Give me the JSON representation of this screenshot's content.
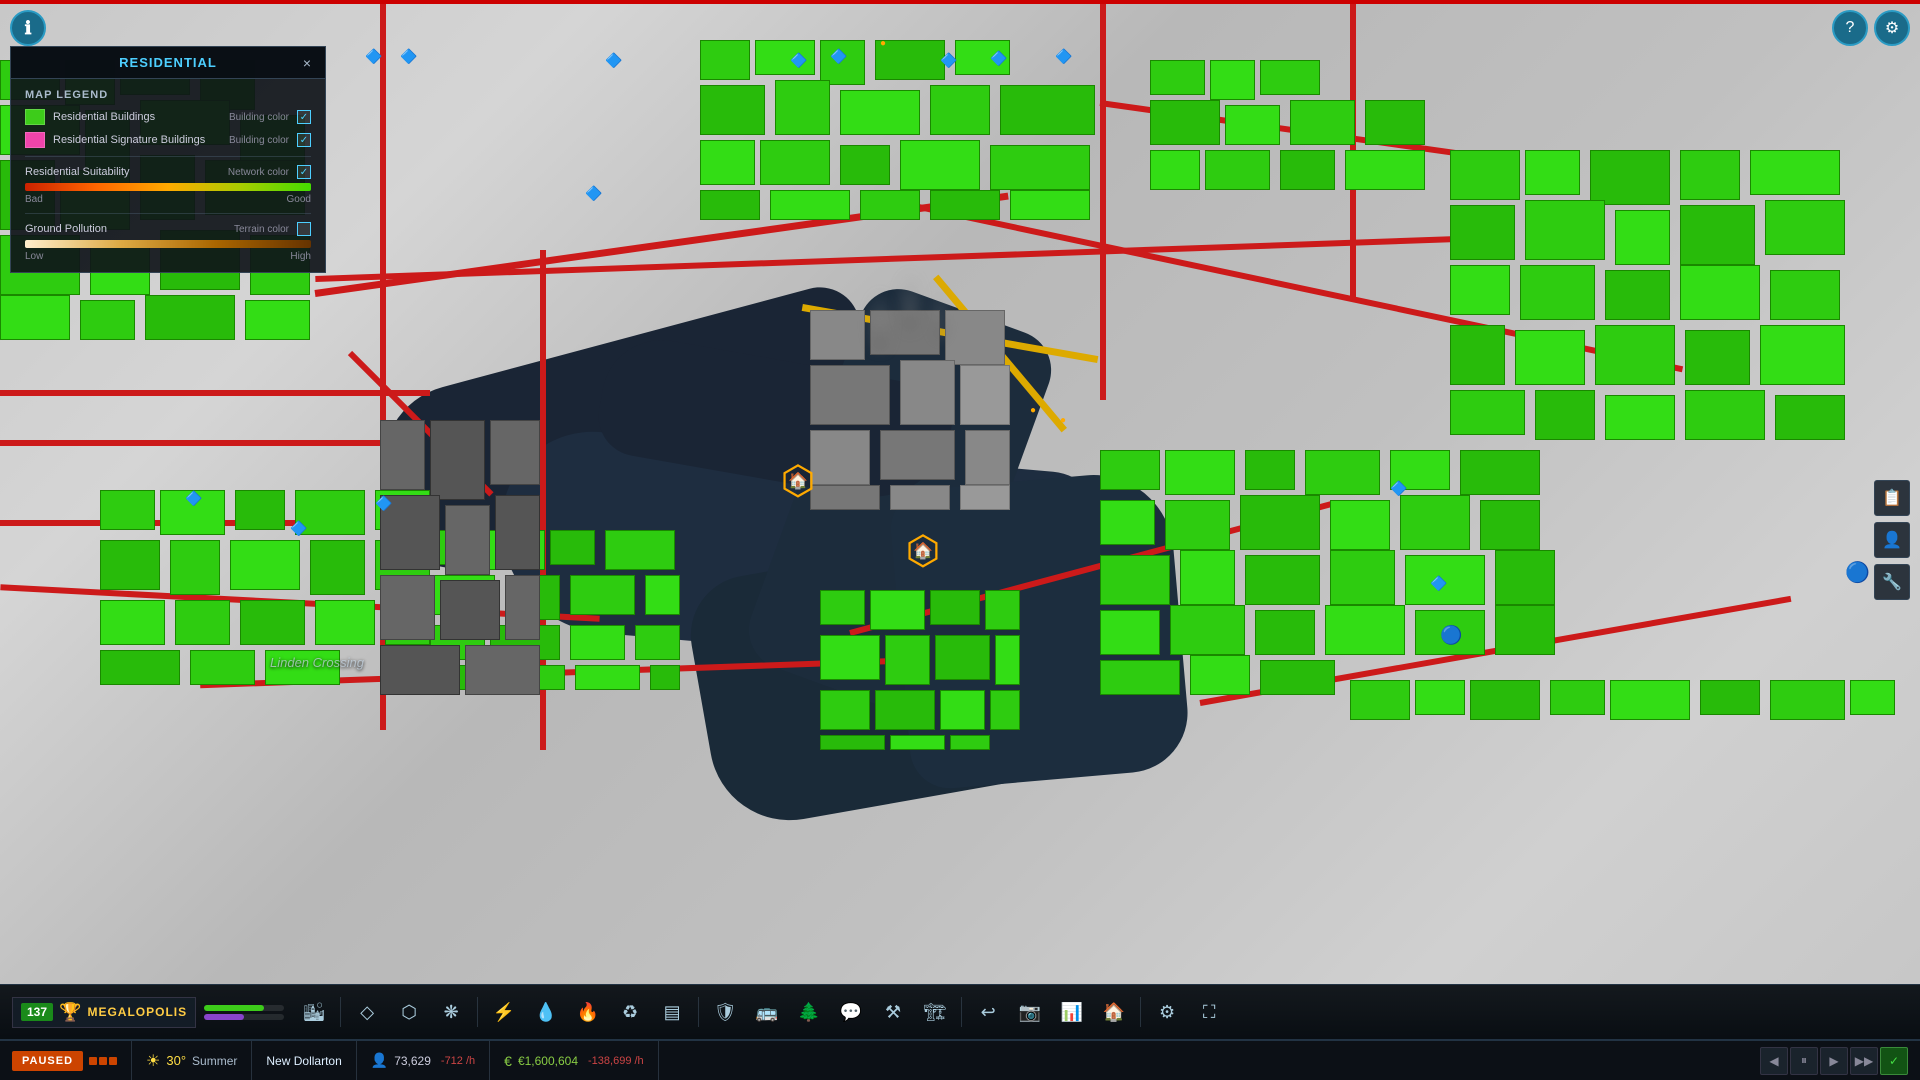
{
  "app": {
    "top_border_color": "#cc0000"
  },
  "legend": {
    "title": "RESIDENTIAL",
    "section_title": "MAP LEGEND",
    "items": [
      {
        "label": "Residential Buildings",
        "sub_label": "Building color",
        "color": "#3dcc1a",
        "checked": true
      },
      {
        "label": "Residential Signature Buildings",
        "sub_label": "Building color",
        "color": "#ee44aa",
        "checked": true
      },
      {
        "label": "Residential Suitability",
        "sub_label": "Network color",
        "checked": true,
        "has_gradient": true,
        "gradient_bad": "Bad",
        "gradient_good": "Good"
      },
      {
        "label": "Ground Pollution",
        "sub_label": "Terrain color",
        "checked": false,
        "has_gradient": true,
        "gradient_low": "Low",
        "gradient_high": "High"
      }
    ],
    "close_btn": "×"
  },
  "toolbar": {
    "city_pop": "137",
    "city_level": "MEGALOPOLIS",
    "icons": [
      {
        "name": "zone",
        "symbol": "◇"
      },
      {
        "name": "road",
        "symbol": "⬡"
      },
      {
        "name": "nature",
        "symbol": "❋"
      },
      {
        "name": "electricity",
        "symbol": "⚡"
      },
      {
        "name": "water",
        "symbol": "💧"
      },
      {
        "name": "fire",
        "symbol": "🔥"
      },
      {
        "name": "recycle",
        "symbol": "♻"
      },
      {
        "name": "map",
        "symbol": "▤"
      },
      {
        "name": "police",
        "symbol": "🛡"
      },
      {
        "name": "transport",
        "symbol": "🚌"
      },
      {
        "name": "park",
        "symbol": "🌲"
      },
      {
        "name": "chat",
        "symbol": "💬"
      },
      {
        "name": "shovel",
        "symbol": "⚒"
      },
      {
        "name": "bulldoze",
        "symbol": "🏗"
      },
      {
        "name": "undo",
        "symbol": "↩"
      },
      {
        "name": "camera",
        "symbol": "📷"
      },
      {
        "name": "chart",
        "symbol": "📊"
      },
      {
        "name": "house",
        "symbol": "🏠"
      },
      {
        "name": "settings-tb",
        "symbol": "⚙"
      },
      {
        "name": "fullscreen",
        "symbol": "⛶"
      }
    ]
  },
  "status_bar": {
    "pause_label": "PAUSED",
    "temperature": "30°",
    "season": "Summer",
    "city_name": "New Dollarton",
    "population": "73,629",
    "pop_change": "-712 /h",
    "money": "€1,600,604",
    "money_change": "-138,699 /h"
  },
  "map": {
    "district_label": "Linden Crossing"
  },
  "buttons": {
    "info": "ℹ",
    "help": "?",
    "settings": "⚙"
  }
}
